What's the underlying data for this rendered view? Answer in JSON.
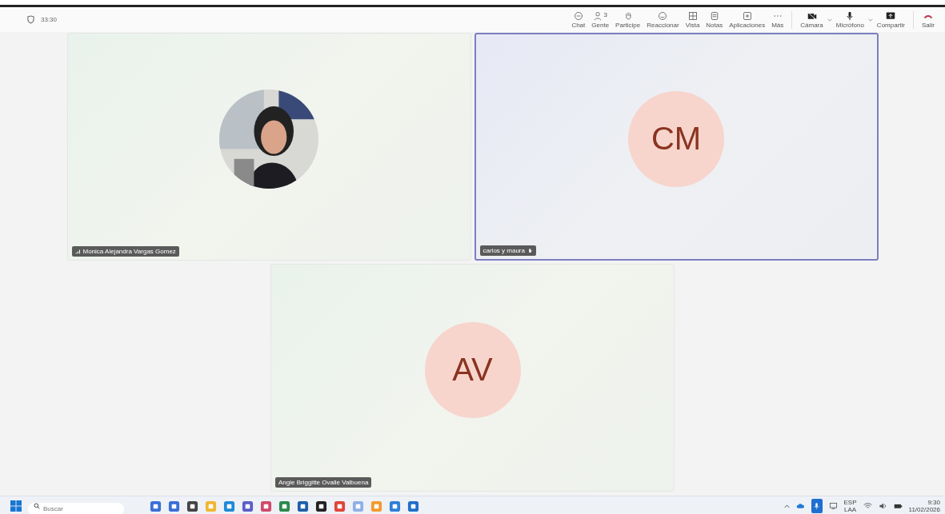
{
  "meeting": {
    "timer": "33:30"
  },
  "toolbar": [
    {
      "kind": "chat",
      "label": "Chat"
    },
    {
      "kind": "people",
      "label": "Gente",
      "count": "3"
    },
    {
      "kind": "hand",
      "label": "Participe"
    },
    {
      "kind": "react",
      "label": "Reaccionar"
    },
    {
      "kind": "view",
      "label": "Vista"
    },
    {
      "kind": "notes",
      "label": "Notas"
    },
    {
      "kind": "apps",
      "label": "Aplicaciones"
    },
    {
      "kind": "more",
      "label": "Más"
    },
    {
      "kind": "camera",
      "label": "Cámara",
      "dropdown": true
    },
    {
      "kind": "mic",
      "label": "Micrófono",
      "dropdown": true
    },
    {
      "kind": "share",
      "label": "Compartir"
    },
    {
      "kind": "leave",
      "label": "Salir"
    }
  ],
  "participants": [
    {
      "name": "Monica Alejandra Vargas Gomez",
      "network_indicator": true,
      "hand_raised": false,
      "selected": false
    },
    {
      "kind": "initials",
      "initials": "CM",
      "name": "carlos y maura",
      "network_indicator": false,
      "hand_raised": true,
      "selected": true
    },
    {
      "kind": "initials",
      "initials": "AV",
      "name": "Angie Briggitte Ovalle Valbuena",
      "network_indicator": false,
      "hand_raised": false,
      "selected": false
    }
  ],
  "taskbar": {
    "search_placeholder": "Buscar",
    "apps": [
      {
        "color": "#3a6fd8"
      },
      {
        "color": "#3a6fd8"
      },
      {
        "color": "#444444"
      },
      {
        "color": "#f2b632"
      },
      {
        "color": "#1f8ad6"
      },
      {
        "color": "#5b5fc7"
      },
      {
        "color": "#d04a6a"
      },
      {
        "color": "#2c8a4a"
      },
      {
        "color": "#1e5fa8"
      },
      {
        "color": "#222222"
      },
      {
        "color": "#e0453a"
      },
      {
        "color": "#8fb0e8"
      },
      {
        "color": "#f29a2e"
      },
      {
        "color": "#2f7fd6"
      },
      {
        "color": "#1f6fc8"
      }
    ],
    "language": "ESP",
    "layout": "LAA",
    "time": "9:30",
    "date": "11/02/2026"
  }
}
